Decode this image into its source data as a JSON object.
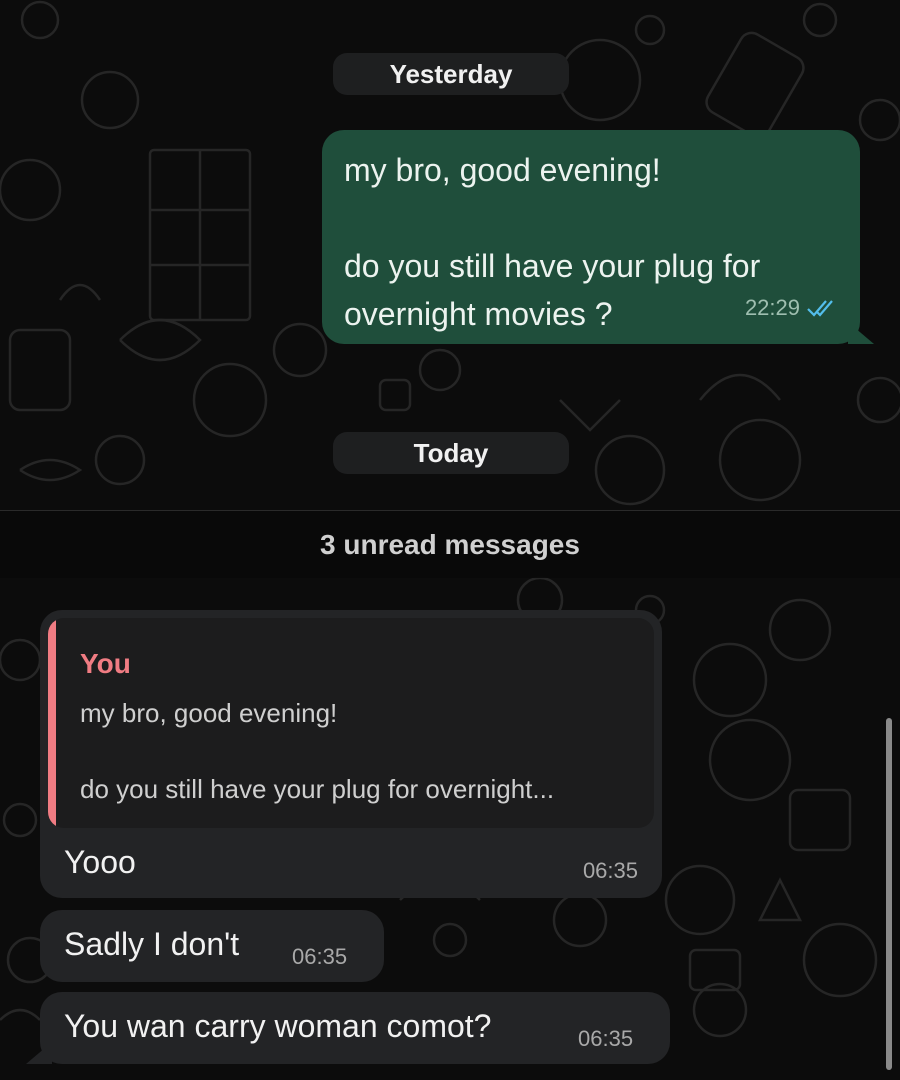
{
  "dividers": {
    "yesterday": "Yesterday",
    "today": "Today",
    "unread": "3 unread messages"
  },
  "messages": {
    "outgoing": {
      "line1": "my bro, good evening!",
      "line2": "do you still have your plug for",
      "line3": "overnight movies ?",
      "time": "22:29",
      "status_icon": "double-check-read-icon"
    },
    "reply": {
      "quote_author": "You",
      "quote_line1": "my bro, good evening!",
      "quote_line2": "do you still have your plug for overnight...",
      "text": "Yooo",
      "time": "06:35"
    },
    "incoming2": {
      "text": "Sadly I don't",
      "time": "06:35"
    },
    "incoming3": {
      "text": "You wan carry woman comot?",
      "time": "06:35"
    }
  },
  "colors": {
    "outgoing_bubble": "#1f4e3b",
    "incoming_bubble": "#232426",
    "quote_accent": "#f07c83",
    "read_ticks": "#53bdeb"
  }
}
